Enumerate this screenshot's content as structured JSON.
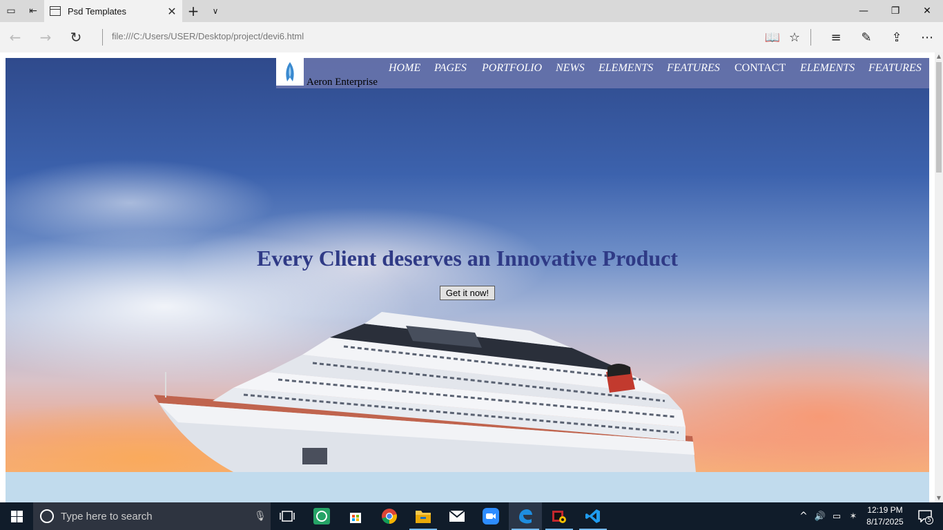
{
  "browser": {
    "tab_title": "Psd Templates",
    "url": "file:///C:/Users/USER/Desktop/project/devi6.html"
  },
  "page": {
    "brand": "Aeron Enterprise",
    "nav": [
      "HOME",
      "PAGES",
      "PORTFOLIO",
      "NEWS",
      "ELEMENTS",
      "FEATURES",
      "CONTACT",
      "ELEMENTS",
      "FEATURES"
    ],
    "headline": "Every Client deserves an Innovative Product",
    "cta_label": "Get it now!"
  },
  "taskbar": {
    "search_placeholder": "Type here to search",
    "time": "12:19 PM",
    "date": "8/17/2025",
    "notifications": "5",
    "apps": [
      "task-view",
      "whatsapp",
      "microsoft-store",
      "chrome",
      "file-explorer",
      "mail",
      "zoom",
      "edge",
      "media-app",
      "vscode"
    ]
  },
  "colors": {
    "headline": "#2f3a86",
    "nav_band": "#6e78af",
    "below_band": "#c1dbed",
    "taskbar": "#101c2a"
  }
}
